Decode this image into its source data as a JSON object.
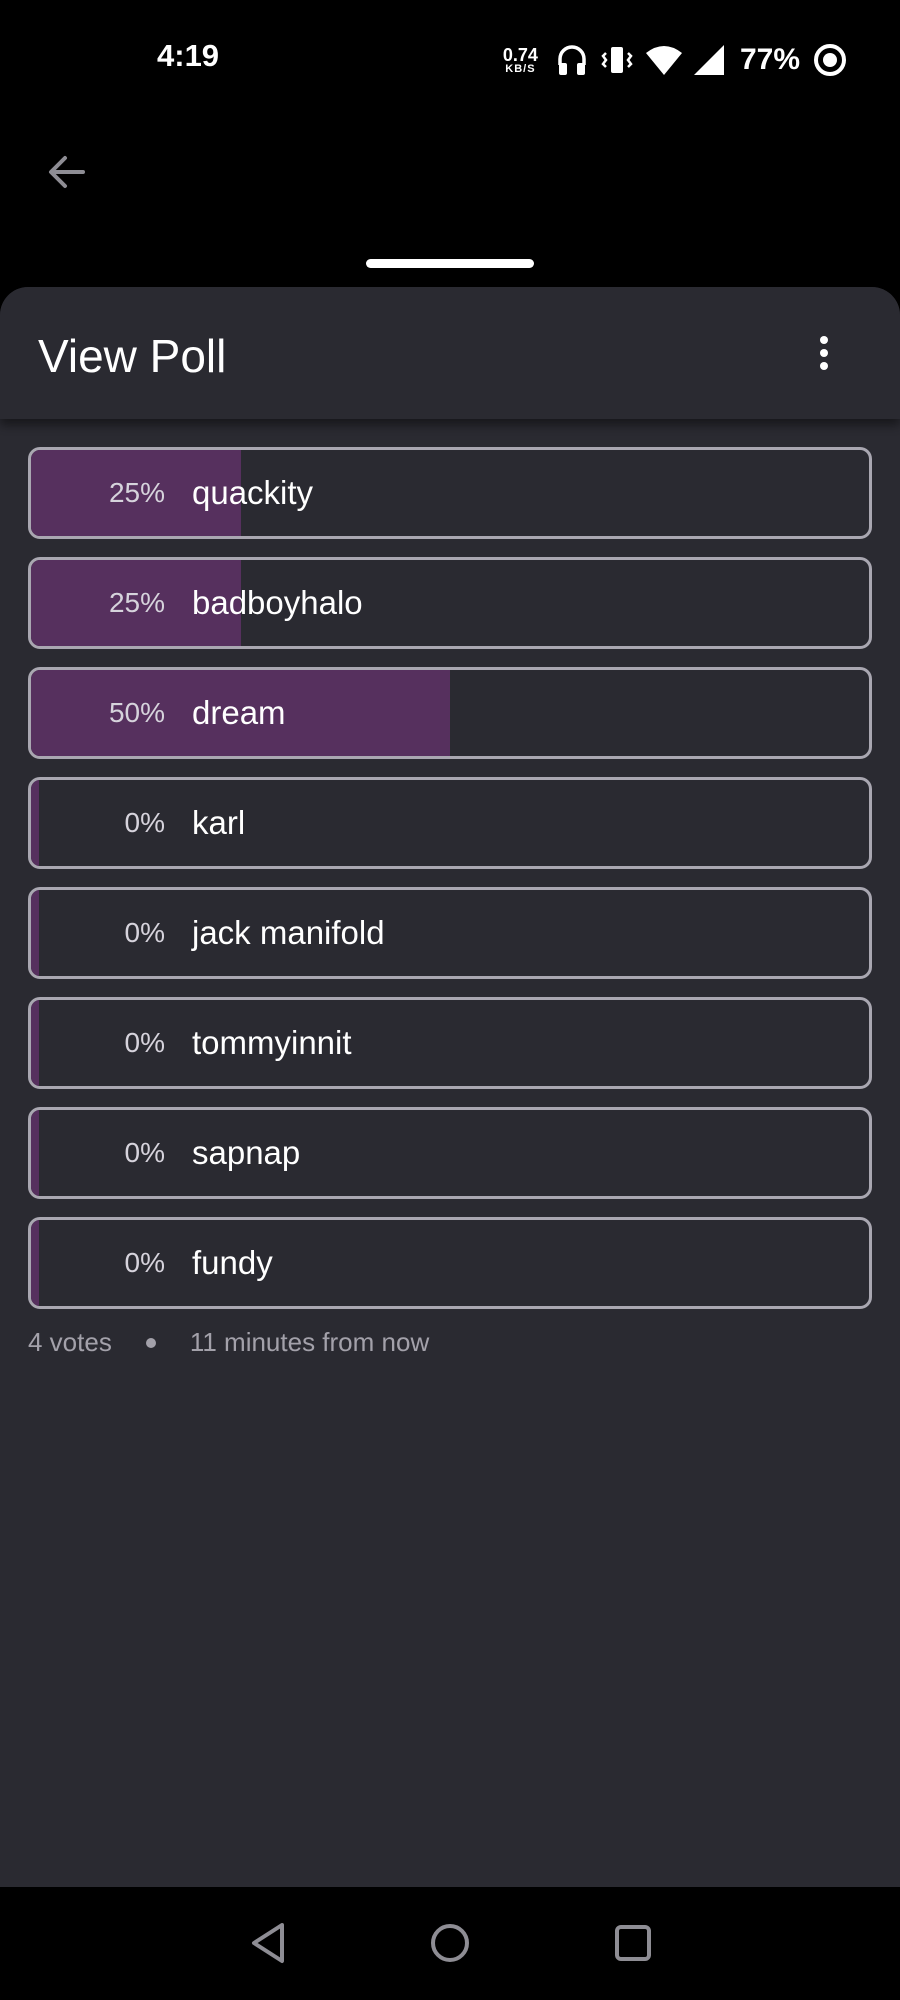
{
  "status_bar": {
    "time": "4:19",
    "net_speed_value": "0.74",
    "net_speed_unit": "KB/S",
    "battery_percent": "77%",
    "icons": [
      "headphones-icon",
      "vibrate-icon",
      "wifi-icon",
      "signal-icon",
      "battery-ring-icon"
    ]
  },
  "header": {
    "title": "View Poll",
    "back_icon": "arrow-left-icon",
    "menu_icon": "more-vertical-icon"
  },
  "poll": {
    "options": [
      {
        "percent": "25%",
        "label": "quackity",
        "fraction": 0.25
      },
      {
        "percent": "25%",
        "label": "badboyhalo",
        "fraction": 0.25
      },
      {
        "percent": "50%",
        "label": "dream",
        "fraction": 0.5
      },
      {
        "percent": "0%",
        "label": "karl",
        "fraction": 0
      },
      {
        "percent": "0%",
        "label": "jack manifold",
        "fraction": 0
      },
      {
        "percent": "0%",
        "label": "tommyinnit",
        "fraction": 0
      },
      {
        "percent": "0%",
        "label": "sapnap",
        "fraction": 0
      },
      {
        "percent": "0%",
        "label": "fundy",
        "fraction": 0
      }
    ],
    "votes": "4 votes",
    "expires": "11 minutes from now"
  },
  "nav": {
    "back": "nav-back-triangle-icon",
    "home": "nav-home-circle-icon",
    "recents": "nav-recents-square-icon"
  },
  "colors": {
    "sheet_bg": "#2a2a31",
    "bar_fill": "#56305e",
    "option_border": "#a9a7b1"
  }
}
